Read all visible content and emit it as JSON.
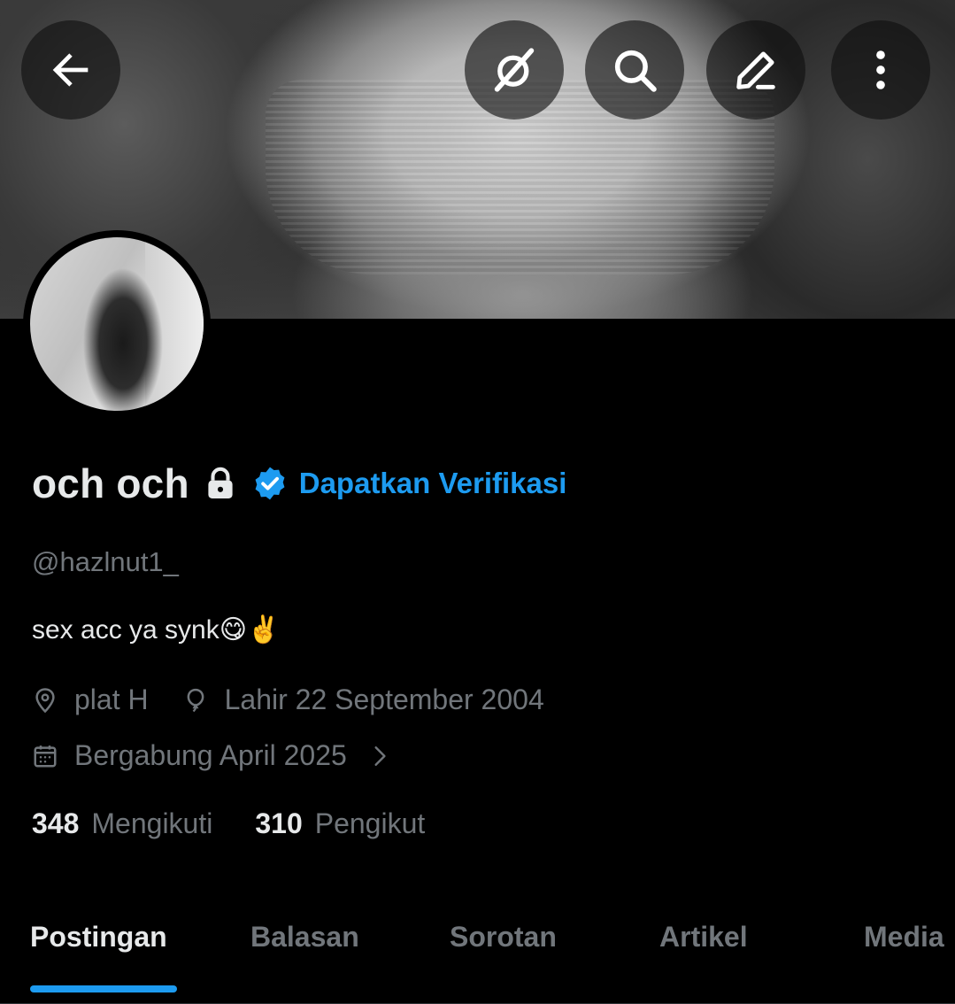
{
  "header": {
    "back_icon": "arrow-left-icon",
    "buttons": [
      {
        "name": "grok-icon"
      },
      {
        "name": "search-icon"
      },
      {
        "name": "edit-icon"
      },
      {
        "name": "more-vertical-icon"
      }
    ]
  },
  "profile": {
    "display_name": "och och",
    "locked_icon": "lock-icon",
    "verify_label": "Dapatkan Verifikasi",
    "handle": "@hazlnut1_",
    "bio": "sex acc ya synk😋✌️",
    "location": "plat H",
    "birthday": "Lahir 22 September 2004",
    "joined": "Bergabung April 2025",
    "following_count": "348",
    "following_label": "Mengikuti",
    "followers_count": "310",
    "followers_label": "Pengikut"
  },
  "tabs": [
    {
      "label": "Postingan",
      "active": true
    },
    {
      "label": "Balasan",
      "active": false
    },
    {
      "label": "Sorotan",
      "active": false
    },
    {
      "label": "Artikel",
      "active": false
    },
    {
      "label": "Media",
      "active": false
    }
  ],
  "colors": {
    "background": "#000000",
    "text_primary": "#e7e9ea",
    "text_secondary": "#71767b",
    "accent": "#1d9bf0"
  }
}
